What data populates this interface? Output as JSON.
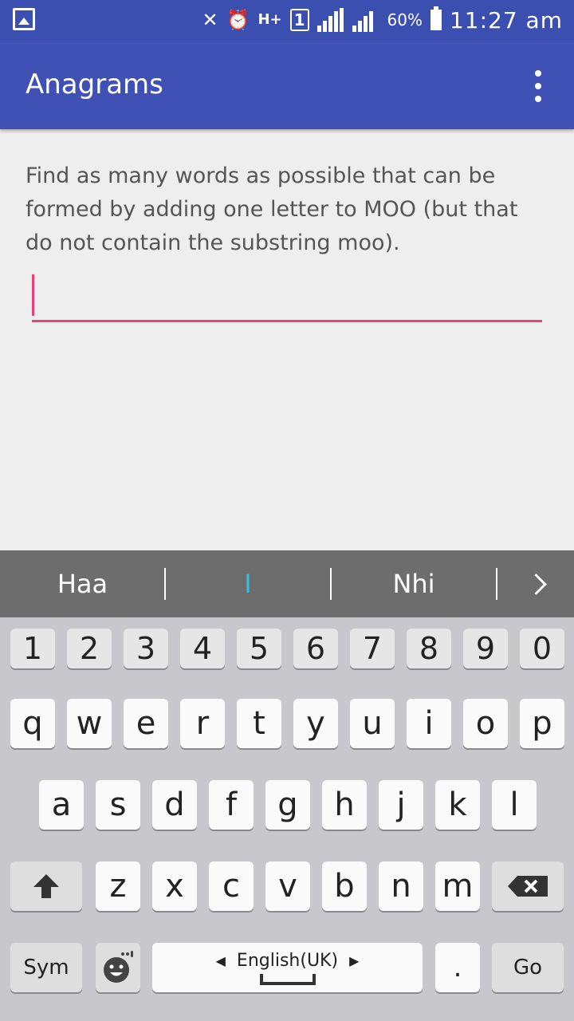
{
  "status_bar": {
    "percent": "60%",
    "time": "11:27 am",
    "sim_label": "1",
    "network": "H+"
  },
  "appbar": {
    "title": "Anagrams"
  },
  "main": {
    "instructions": "Find as many words as possible that can be formed by adding one letter to MOO (but that do not contain the substring moo).",
    "input_value": ""
  },
  "suggestions": [
    "Haa",
    "I",
    "Nhi"
  ],
  "keyboard": {
    "numbers": [
      "1",
      "2",
      "3",
      "4",
      "5",
      "6",
      "7",
      "8",
      "9",
      "0"
    ],
    "row1": [
      "q",
      "w",
      "e",
      "r",
      "t",
      "y",
      "u",
      "i",
      "o",
      "p"
    ],
    "row2": [
      "a",
      "s",
      "d",
      "f",
      "g",
      "h",
      "j",
      "k",
      "l"
    ],
    "row3": [
      "z",
      "x",
      "c",
      "v",
      "b",
      "n",
      "m"
    ],
    "sym_label": "Sym",
    "space_label": "English(UK)",
    "go_label": "Go",
    "punct_label": "."
  },
  "colors": {
    "primary": "#3f51b5",
    "accent": "#e8407a"
  }
}
